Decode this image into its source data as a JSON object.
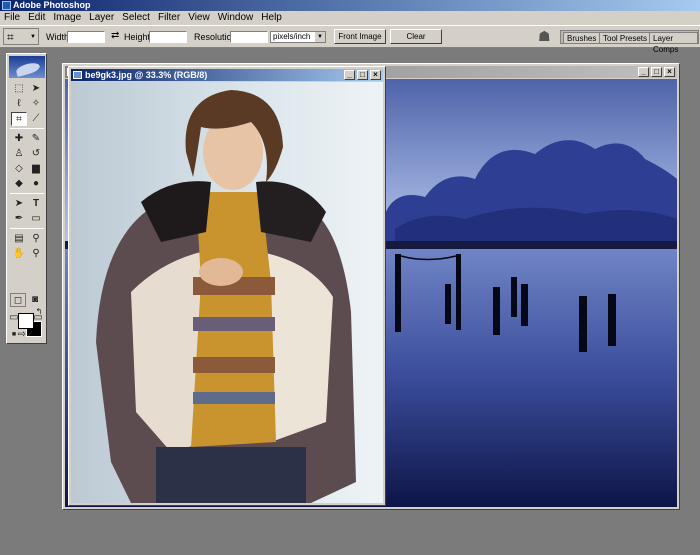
{
  "app": {
    "title": "Adobe Photoshop"
  },
  "menu": [
    "File",
    "Edit",
    "Image",
    "Layer",
    "Select",
    "Filter",
    "View",
    "Window",
    "Help"
  ],
  "options": {
    "width_label": "Width:",
    "height_label": "Height:",
    "resolution_label": "Resolution:",
    "width_value": "",
    "height_value": "",
    "resolution_value": "",
    "units_value": "pixels/inch",
    "front_image_label": "Front Image",
    "clear_label": "Clear"
  },
  "palette_well": {
    "tabs": [
      "Brushes",
      "Tool Presets",
      "Layer Comps"
    ]
  },
  "documents": {
    "front": {
      "title": "be9gk3.jpg @ 33.3% (RGB/8)"
    },
    "back": {
      "title": ""
    }
  },
  "colors": {
    "title_active": "#0a246a",
    "chrome": "#d4d0c8",
    "workspace": "#7b7b7b",
    "foreground": "#ffffff",
    "background": "#000000"
  },
  "toolbox": {
    "tools": [
      "marquee-icon",
      "move-icon",
      "lasso-icon",
      "magic-wand-icon",
      "crop-icon",
      "slice-icon",
      "healing-brush-icon",
      "brush-icon",
      "clone-stamp-icon",
      "history-brush-icon",
      "eraser-icon",
      "gradient-icon",
      "blur-icon",
      "dodge-icon",
      "path-selection-icon",
      "type-icon",
      "pen-icon",
      "shape-icon",
      "notes-icon",
      "eyedropper-icon",
      "hand-icon",
      "zoom-icon"
    ]
  }
}
